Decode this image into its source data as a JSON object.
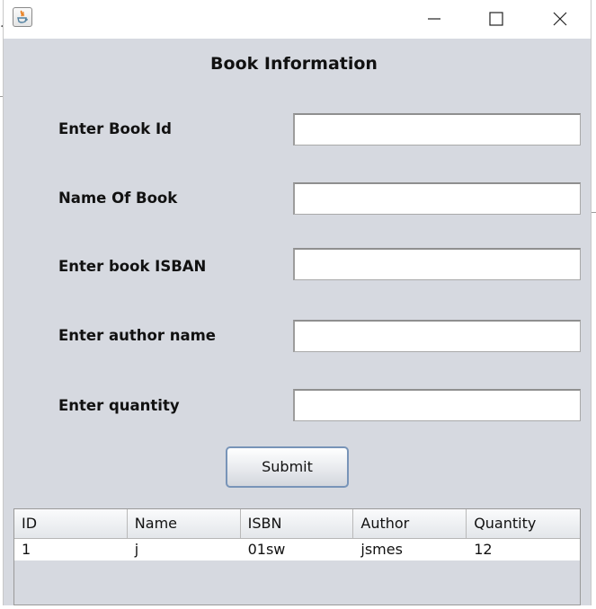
{
  "window": {
    "title": "",
    "icon": "java-cup-icon"
  },
  "form": {
    "title": "Book Information",
    "fields": [
      {
        "label": "Enter Book Id",
        "value": "",
        "placeholder": ""
      },
      {
        "label": "Name Of Book",
        "value": "",
        "placeholder": ""
      },
      {
        "label": "Enter book ISBAN",
        "value": "",
        "placeholder": ""
      },
      {
        "label": "Enter author name",
        "value": "",
        "placeholder": ""
      },
      {
        "label": "Enter quantity",
        "value": "",
        "placeholder": ""
      }
    ],
    "submit_label": "Submit"
  },
  "table": {
    "columns": [
      "ID",
      "Name",
      "ISBN",
      "Author",
      "Quantity"
    ],
    "rows": [
      [
        "1",
        "j",
        "01sw",
        "jsmes",
        "12"
      ]
    ]
  },
  "colors": {
    "panel_bg": "#d6d9e0",
    "button_border": "#7894b8"
  }
}
